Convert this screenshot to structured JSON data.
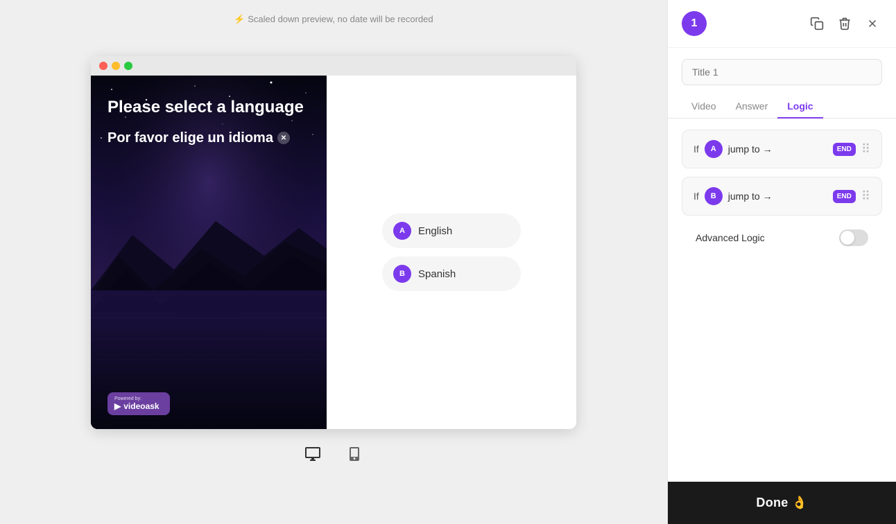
{
  "preview": {
    "notice": "⚡ Scaled down preview, no date will be recorded",
    "video_title": "Please select a language",
    "video_subtitle": "Por favor elige un idioma",
    "powered_by": "Powered by:",
    "powered_brand": "videoask",
    "answers": [
      {
        "id": "A",
        "label": "English"
      },
      {
        "id": "B",
        "label": "Spanish"
      }
    ]
  },
  "panel": {
    "step_number": "1",
    "title_placeholder": "Title 1",
    "tabs": [
      {
        "id": "video",
        "label": "Video"
      },
      {
        "id": "answer",
        "label": "Answer"
      },
      {
        "id": "logic",
        "label": "Logic"
      }
    ],
    "active_tab": "logic",
    "logic_rules": [
      {
        "if_label": "If",
        "answer_id": "A",
        "jump_label": "jump to →",
        "end_label": "END"
      },
      {
        "if_label": "If",
        "answer_id": "B",
        "jump_label": "jump to →",
        "end_label": "END"
      }
    ],
    "advanced_logic_label": "Advanced Logic",
    "done_label": "Done 👌"
  },
  "icons": {
    "copy": "⧉",
    "trash": "🗑",
    "close": "✕",
    "desktop": "🖥",
    "mobile": "📱",
    "drag": "⠿"
  }
}
